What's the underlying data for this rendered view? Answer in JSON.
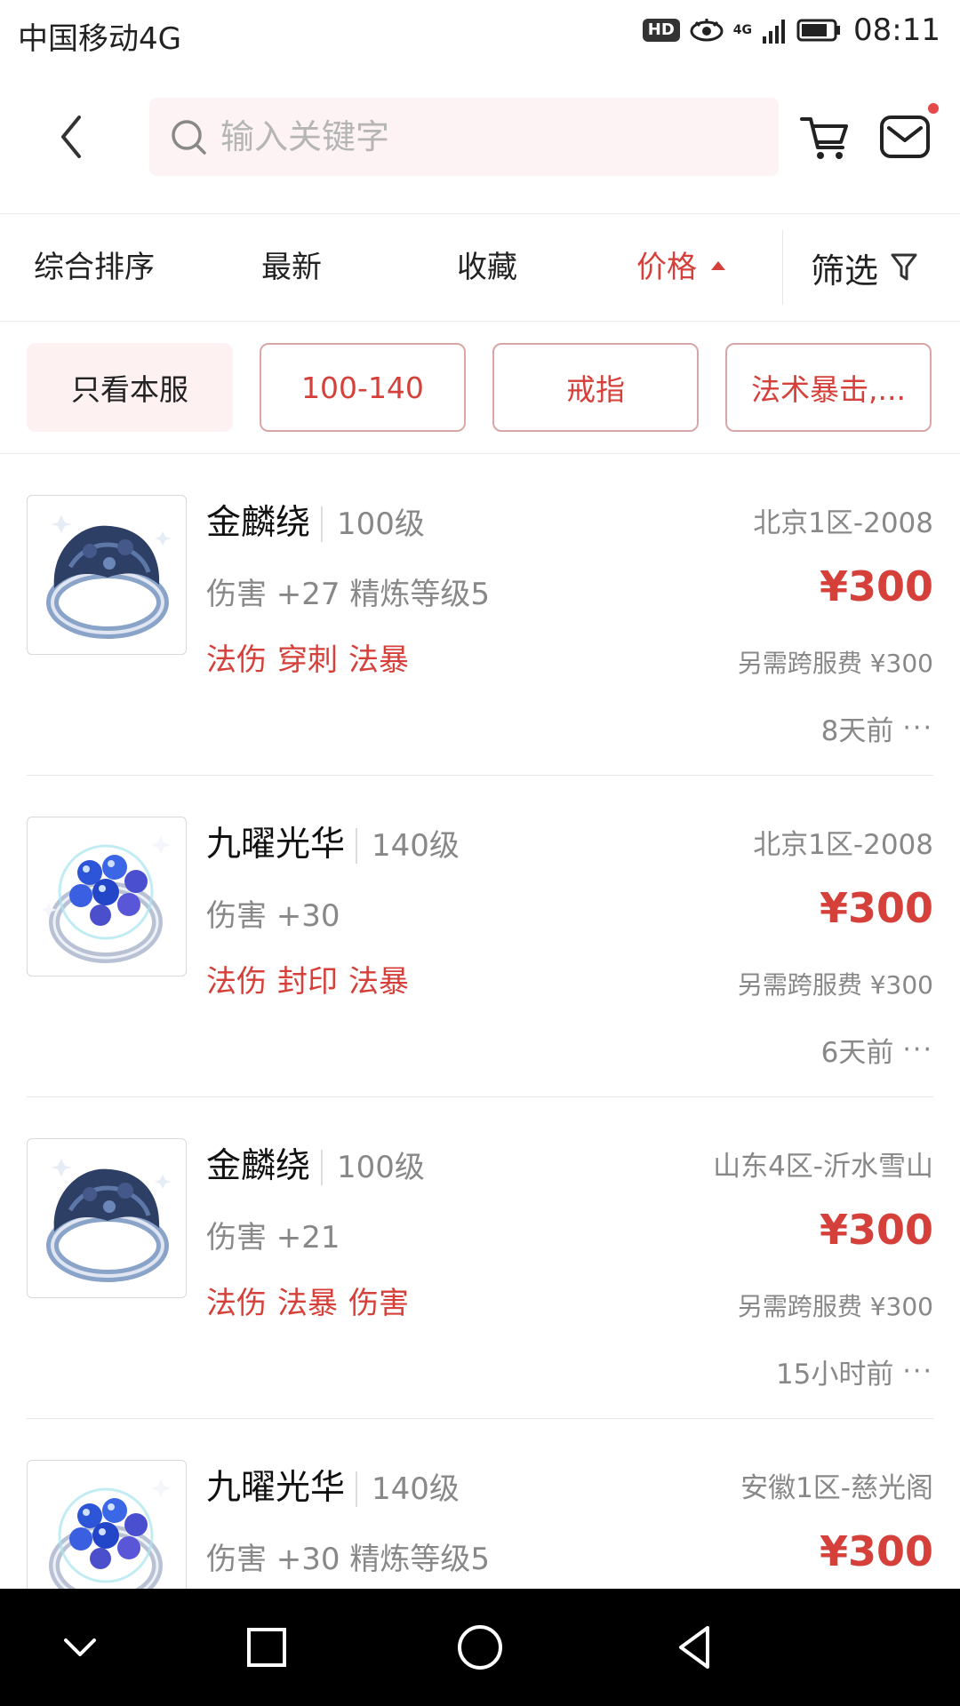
{
  "status_bar": {
    "carrier": "中国移动4G",
    "hd": "HD",
    "network": "4G",
    "time": "08:11"
  },
  "header": {
    "search_placeholder": "输入关键字"
  },
  "sort_tabs": [
    {
      "label": "综合排序",
      "active": false
    },
    {
      "label": "最新",
      "active": false
    },
    {
      "label": "收藏",
      "active": false
    },
    {
      "label": "价格",
      "active": true,
      "direction": "ascending"
    }
  ],
  "filter_label": "筛选",
  "chips": [
    {
      "label": "只看本服",
      "style": "plain"
    },
    {
      "label": "100-140",
      "style": "outlined"
    },
    {
      "label": "戒指",
      "style": "outlined"
    },
    {
      "label": "法术暴击,...",
      "style": "outlined"
    }
  ],
  "items": [
    {
      "name": "金麟绕",
      "level": "100级",
      "stats": "伤害 +27 精炼等级5",
      "tags": [
        "法伤",
        "穿刺",
        "法暴"
      ],
      "server": "北京1区-2008",
      "price": "¥300",
      "fee": "另需跨服费 ¥300",
      "time": "8天前",
      "image": "dark-ring-icon"
    },
    {
      "name": "九曜光华",
      "level": "140级",
      "stats": "伤害 +30",
      "tags": [
        "法伤",
        "封印",
        "法暴"
      ],
      "server": "北京1区-2008",
      "price": "¥300",
      "fee": "另需跨服费 ¥300",
      "time": "6天前",
      "image": "blue-gem-ring-icon"
    },
    {
      "name": "金麟绕",
      "level": "100级",
      "stats": "伤害 +21",
      "tags": [
        "法伤",
        "法暴",
        "伤害"
      ],
      "server": "山东4区-沂水雪山",
      "price": "¥300",
      "fee": "另需跨服费 ¥300",
      "time": "15小时前",
      "image": "dark-ring-icon"
    },
    {
      "name": "九曜光华",
      "level": "140级",
      "stats": "伤害 +30 精炼等级5",
      "tags": [],
      "server": "安徽1区-慈光阁",
      "price": "¥300",
      "fee": "",
      "time": "",
      "image": "blue-gem-ring-icon"
    }
  ],
  "colors": {
    "accent": "#d6403a",
    "search_bg": "#fdf3f4",
    "chip_plain_bg": "#fdf1f2",
    "chip_border": "#d8a6a6",
    "nav_bar": "#000000"
  }
}
